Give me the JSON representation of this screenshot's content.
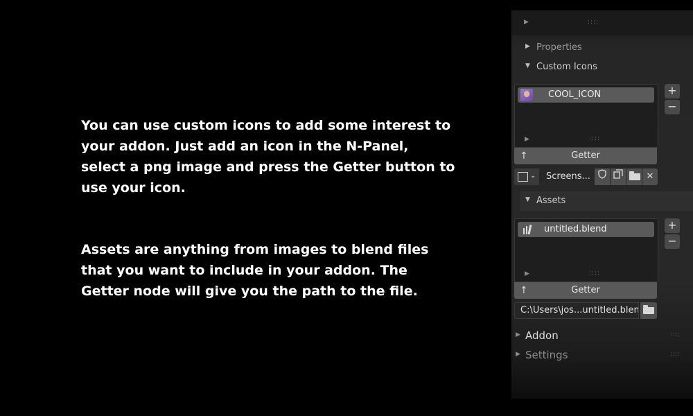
{
  "text": {
    "custom_icons_paragraph": "You can use custom icons to add some interest to your addon. Just add an icon in the N-Panel, select a png image and press the Getter button to use your icon.",
    "assets_paragraph": "Assets are anything from images to blend files that you want to include in your addon. The Getter node will give you the path to the file."
  },
  "panel": {
    "properties_label": "Properties",
    "custom_icons": {
      "label": "Custom Icons",
      "items": [
        {
          "label": "COOL_ICON"
        }
      ],
      "getter_label": "Getter",
      "image_name": "Screens...",
      "add_label": "+",
      "remove_label": "−"
    },
    "assets": {
      "label": "Assets",
      "items": [
        {
          "label": "untitled.blend"
        }
      ],
      "getter_label": "Getter",
      "path_value": "C:\\Users\\jos...untitled.blend",
      "add_label": "+",
      "remove_label": "−"
    },
    "addon_label": "Addon",
    "settings_label": "Settings"
  },
  "colors": {
    "background": "#000000",
    "panel": "#282828",
    "list_item": "#5a5a5a",
    "getter_button": "#595959"
  },
  "icons": [
    "image-icon",
    "shield-icon",
    "duplicate-icon",
    "folder-icon",
    "close-icon",
    "blend-file-icon",
    "arrow-up-icon",
    "grip-icon",
    "disclosure-triangle-icon"
  ]
}
